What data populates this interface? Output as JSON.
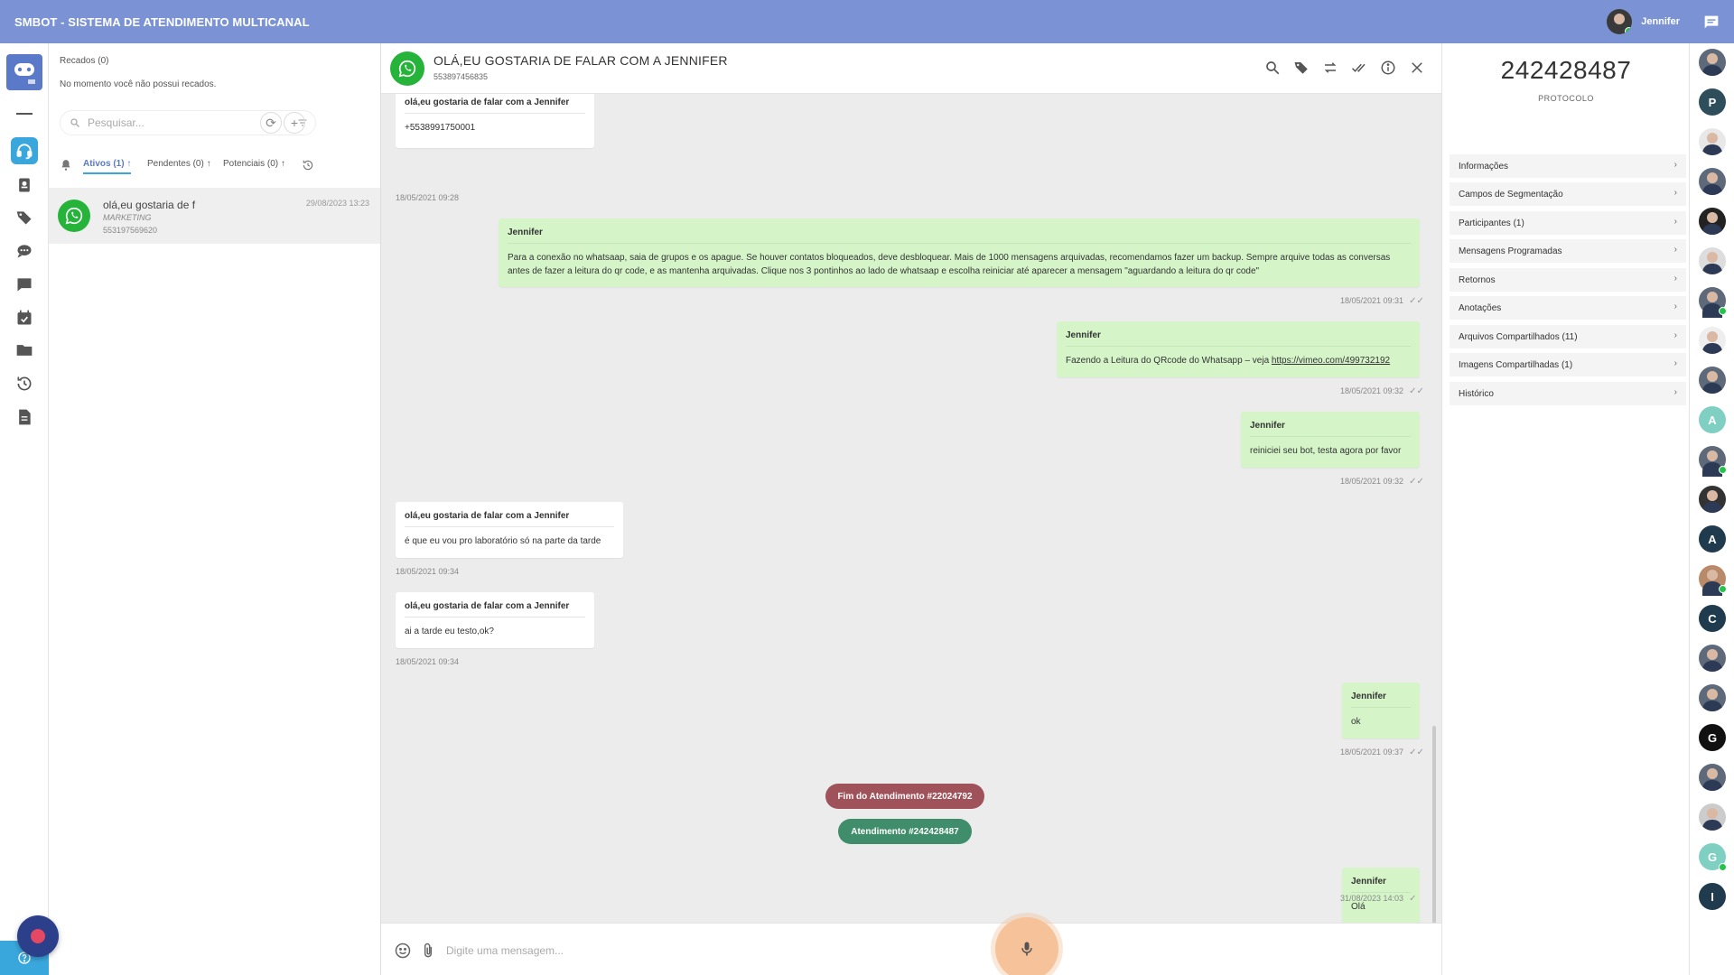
{
  "app": {
    "title": "SMBOT - SISTEMA DE ATENDIMENTO MULTICANAL",
    "user_name": "Jennifer"
  },
  "recados": {
    "title": "Recados (0)",
    "message": "No momento você não possui recados."
  },
  "search": {
    "placeholder": "Pesquisar..."
  },
  "tabs": [
    {
      "label": "Ativos (1)",
      "arrow": "↑"
    },
    {
      "label": "Pendentes (0)",
      "arrow": "↑"
    },
    {
      "label": "Potenciais (0)",
      "arrow": "↑"
    }
  ],
  "conversation": {
    "name": "olá,eu gostaria de f",
    "tag": "MARKETING",
    "phone": "553197569620",
    "date": "29/08/2023 13:23"
  },
  "chat": {
    "title": "OLÁ,EU GOSTARIA DE FALAR COM A JENNIFER",
    "subtitle": "553897456835",
    "messages": [
      {
        "dir": "in",
        "who": "olá,eu gostaria de falar com a Jennifer",
        "text": "+5538991750001",
        "time": "18/05/2021 09:28"
      },
      {
        "dir": "out",
        "who": "Jennifer",
        "text": "Para a conexão no whatsaap, saia de grupos e os apague. Se houver contatos bloqueados, deve desbloquear. Mais de 1000 mensagens arquivadas, recomendamos fazer um backup. Sempre arquive todas as conversas antes de fazer a leitura do qr code, e as mantenha arquivadas. Clique nos 3 pontinhos ao lado de whatsaap e escolha reiniciar até aparecer a mensagem \"aguardando a leitura do qr code\"",
        "time": "18/05/2021 09:31"
      },
      {
        "dir": "out",
        "who": "Jennifer",
        "text": "Fazendo a Leitura do QRcode do Whatsapp – veja ",
        "link": "https://vimeo.com/499732192",
        "time": "18/05/2021 09:32"
      },
      {
        "dir": "out",
        "who": "Jennifer",
        "text": "reiniciei seu bot, testa agora por favor",
        "time": "18/05/2021 09:32"
      },
      {
        "dir": "in",
        "who": "olá,eu gostaria de falar com a Jennifer",
        "text": "é que eu vou pro laboratório só na parte da tarde",
        "time": "18/05/2021 09:34"
      },
      {
        "dir": "in",
        "who": "olá,eu gostaria de falar com a Jennifer",
        "text": "ai a tarde eu testo,ok?",
        "time": "18/05/2021 09:34"
      },
      {
        "dir": "out",
        "who": "Jennifer",
        "text": "ok",
        "time": "18/05/2021 09:37"
      },
      {
        "dir": "out",
        "who": "Jennifer",
        "text": "Olá",
        "time": "31/08/2023 14:03"
      }
    ],
    "end_pill": "Fim do Atendimento #22024792",
    "start_pill": "Atendimento #242428487",
    "composer_placeholder": "Digite uma mensagem..."
  },
  "protocol": {
    "number": "242428487",
    "label": "PROTOCOLO"
  },
  "info_items": [
    "Informações",
    "Campos de Segmentação",
    "Participantes (1)",
    "Mensagens Programadas",
    "Retornos",
    "Anotações",
    "Arquivos Compartilhados (11)",
    "Imagens Compartilhadas (1)",
    "Histórico"
  ],
  "agents": [
    "",
    "P",
    "",
    "",
    "",
    "",
    "",
    "",
    "",
    "A",
    "",
    "",
    "A",
    "",
    "C",
    "",
    "",
    "G",
    "",
    "",
    "G",
    "I"
  ],
  "colors": {
    "topbar": "#7b93d4",
    "accent": "#3aa7dc",
    "whatsapp": "#25b33a",
    "outgoing": "#d5f5c9",
    "end_pill": "#a0525a",
    "start_pill": "#3f8d6a"
  }
}
